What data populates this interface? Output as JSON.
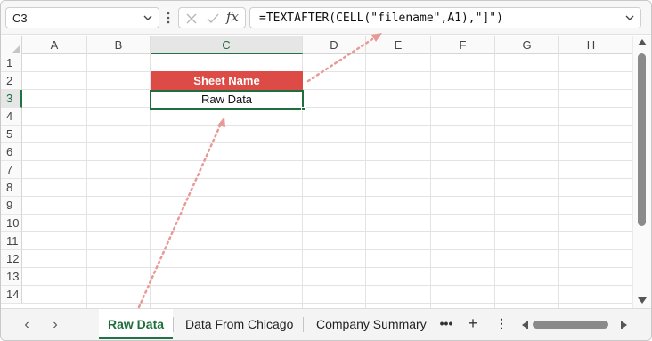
{
  "name_box": {
    "value": "C3",
    "dropdown_icon": "chevron-down-icon"
  },
  "formula_bar": {
    "cancel_icon": "x-icon",
    "enter_icon": "checkmark-icon",
    "insert_function_label": "fx",
    "formula": "=TEXTAFTER(CELL(\"filename\",A1),\"]\")"
  },
  "grid": {
    "columns": [
      "A",
      "B",
      "C",
      "D",
      "E",
      "F",
      "G",
      "H"
    ],
    "selected_column": "C",
    "rows": [
      "1",
      "2",
      "3",
      "4",
      "5",
      "6",
      "7",
      "8",
      "9",
      "10",
      "11",
      "12",
      "13",
      "14"
    ],
    "selected_row": "3",
    "cells": {
      "C2": {
        "value": "Sheet Name",
        "fill": "#dc4b45",
        "text_color": "#ffffff"
      },
      "C3": {
        "value": "Raw Data"
      }
    }
  },
  "annotation_color": "#e89a96",
  "sheet_tabs": {
    "tabs": [
      {
        "label": "Raw Data",
        "active": true
      },
      {
        "label": "Data From Chicago",
        "active": false
      },
      {
        "label": "Company Summary",
        "active": false
      }
    ],
    "more_label": "•••",
    "add_label": "+",
    "options_label": "⋮"
  },
  "accent_color": "#217346"
}
